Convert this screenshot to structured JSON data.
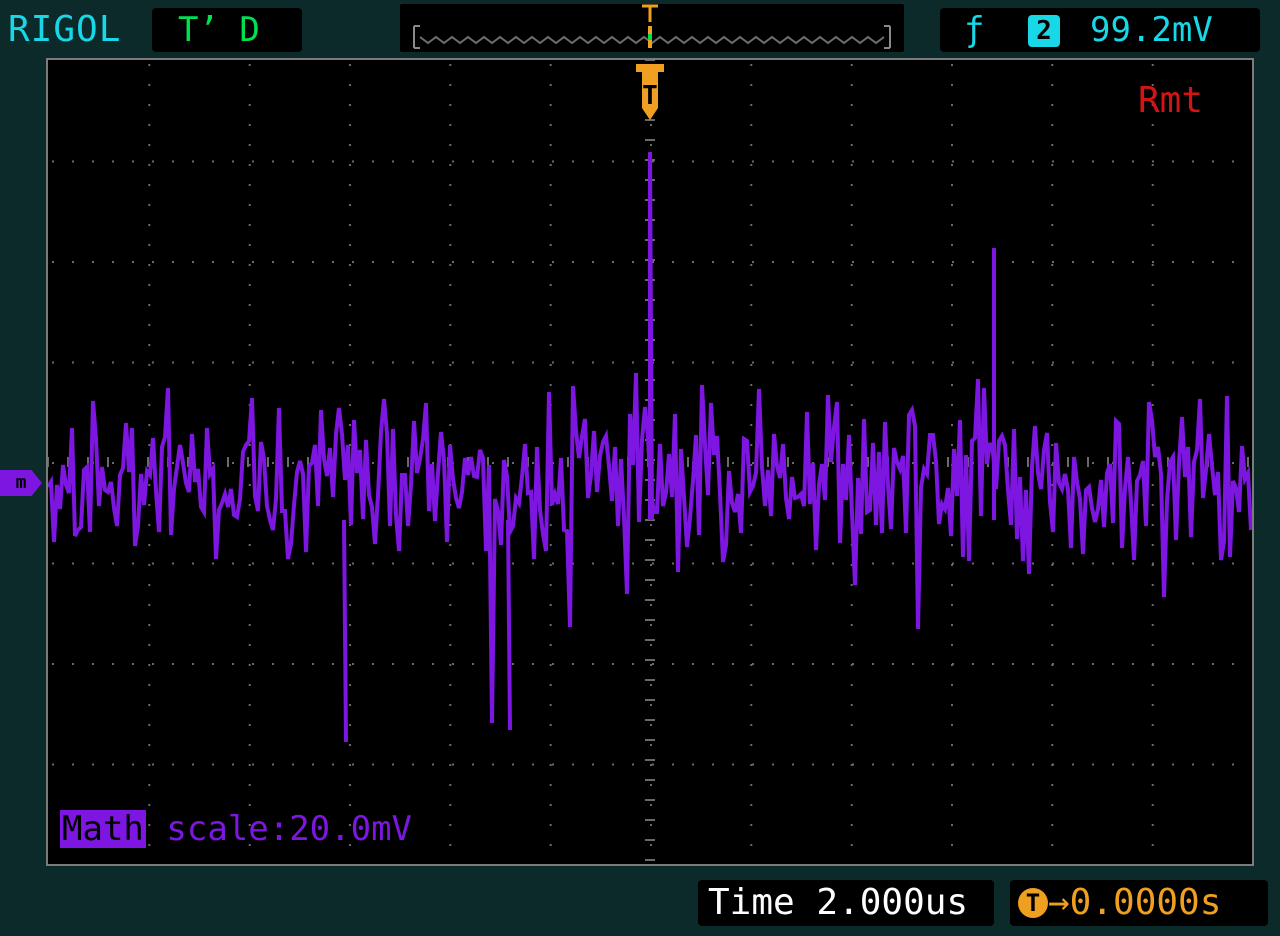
{
  "header": {
    "brand": "RIGOL",
    "run_status": "T’ D",
    "trigger": {
      "edge_icon": "rising-edge-icon",
      "edge_symbol": "ƒ",
      "source": "2",
      "level": "99.2mV"
    }
  },
  "screen": {
    "remote_indicator": "Rmt",
    "trigger_marker": "T",
    "channel_marker": "m",
    "math_tag": "Math",
    "math_scale": "scale:20.0mV"
  },
  "footer": {
    "timebase": "Time 2.000us",
    "trigger_offset_glyph": "T",
    "trigger_offset": "→0.0000s"
  },
  "colors": {
    "background": "#0d2a2a",
    "cyan": "#18d7e6",
    "math_purple": "#7d16e0",
    "status_green": "#00e050",
    "trigger_orange": "#f0a020",
    "remote_red": "#d21414"
  }
}
